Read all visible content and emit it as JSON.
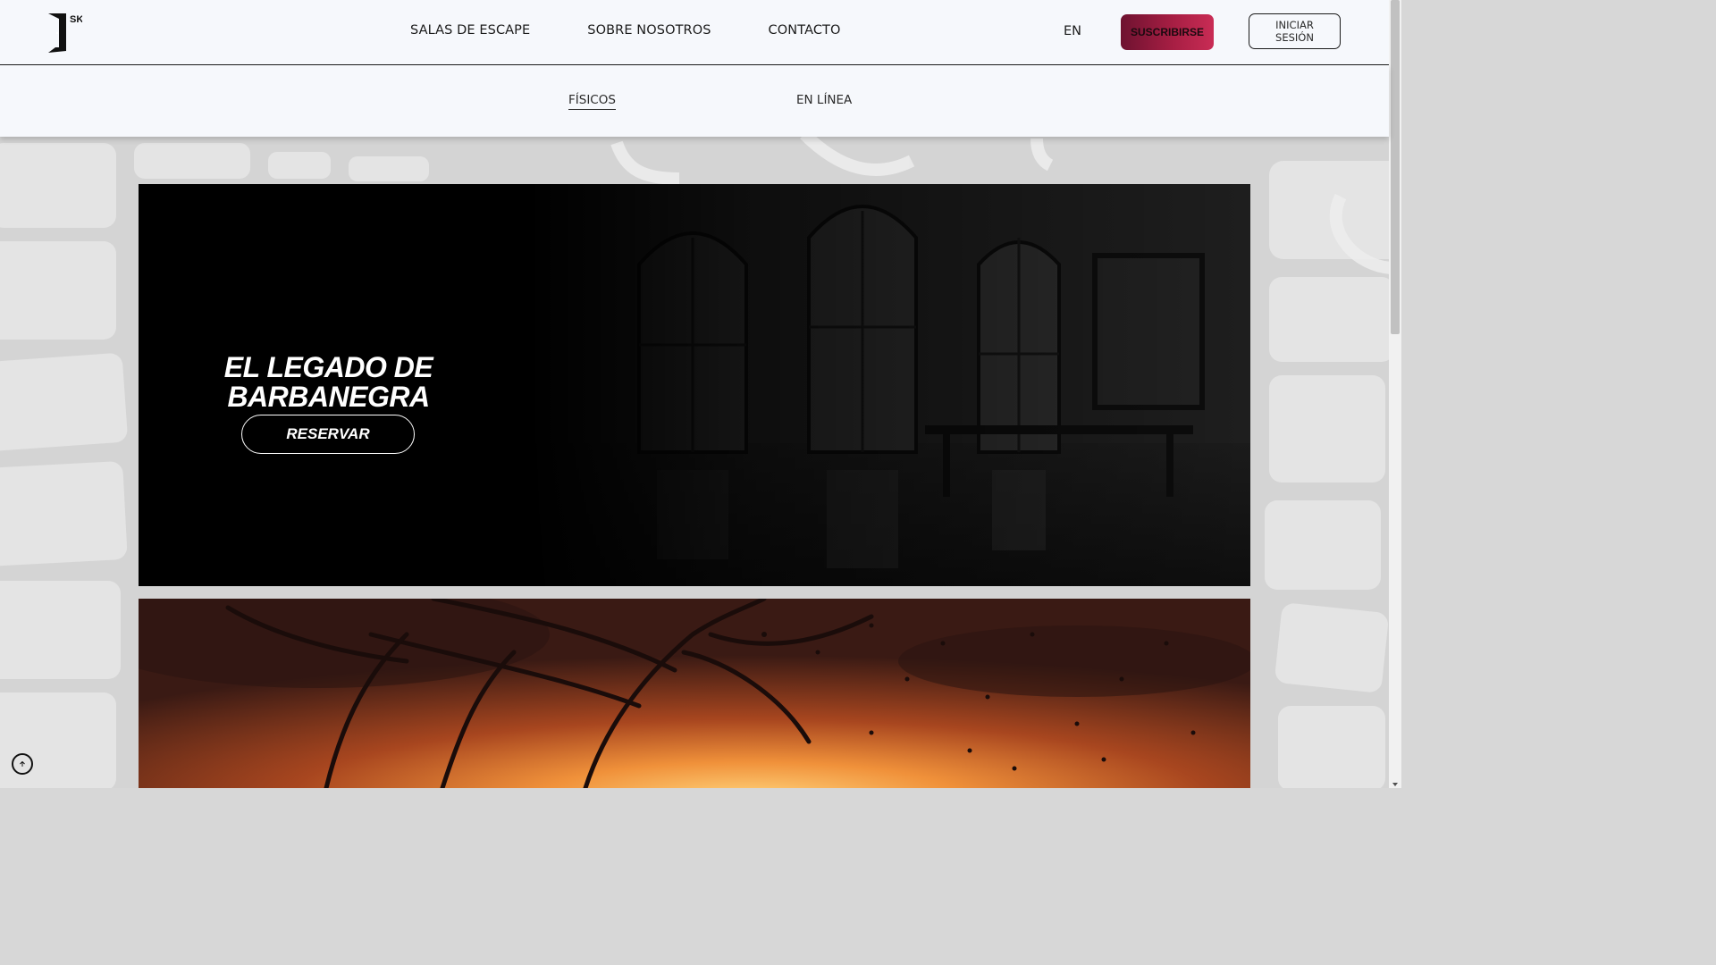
{
  "logo": {
    "text": "SKP"
  },
  "nav": {
    "items": [
      {
        "label": "SALAS DE ESCAPE"
      },
      {
        "label": "SOBRE NOSOTROS"
      },
      {
        "label": "CONTACTO"
      }
    ],
    "language": "EN",
    "subscribe": "SUSCRIBIRSE",
    "login": "INICIAR SESIÓN"
  },
  "subnav": {
    "tabs": [
      {
        "label": "FÍSICOS",
        "active": true
      },
      {
        "label": "EN LÍNEA",
        "active": false
      }
    ]
  },
  "rooms": [
    {
      "title_line1": "EL LEGADO DE",
      "title_line2": "BARBANEGRA",
      "button": "RESERVAR"
    }
  ],
  "colors": {
    "accent": "#a61e43",
    "topbar": "#f6f8fc",
    "background": "#d7d7d7"
  },
  "icons": {
    "back_to_top": "arrow-up-circle-icon"
  }
}
